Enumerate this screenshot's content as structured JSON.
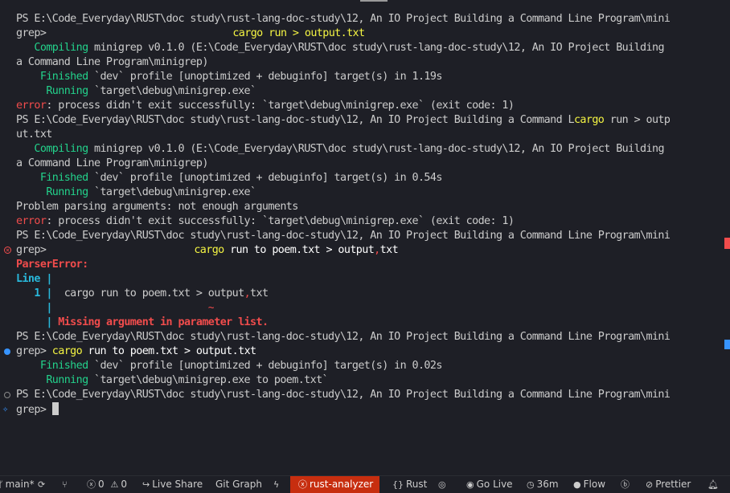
{
  "terminal": {
    "l1a": "PS E:\\Code_Everyday\\RUST\\doc study\\rust-lang-doc-study\\12, An IO Project Building a Command Line Program\\mini",
    "l2_prompt": "grep>",
    "l2_cmd": "cargo run > output.txt",
    "l3_kw": "Compiling",
    "l3_rest": " minigrep v0.1.0 (E:\\Code_Everyday\\RUST\\doc study\\rust-lang-doc-study\\12, An IO Project Building",
    "l4": "a Command Line Program\\minigrep)",
    "l5_kw": "Finished",
    "l5_rest": " `dev` profile [unoptimized + debuginfo] target(s) in 1.19s",
    "l6_kw": "Running",
    "l6_rest": " `target\\debug\\minigrep.exe`",
    "l7_kw": "error",
    "l7_rest": ": process didn't exit successfully: `target\\debug\\minigrep.exe` (exit code: 1)",
    "l8a": "PS E:\\Code_Everyday\\RUST\\doc study\\rust-lang-doc-study\\12, An IO Project Building a Command L",
    "l8_cmd": "cargo",
    "l8_rest": " run > outp",
    "l9": "ut.txt",
    "l10_kw": "Compiling",
    "l10_rest": " minigrep v0.1.0 (E:\\Code_Everyday\\RUST\\doc study\\rust-lang-doc-study\\12, An IO Project Building",
    "l11": "a Command Line Program\\minigrep)",
    "l12_kw": "Finished",
    "l12_rest": " `dev` profile [unoptimized + debuginfo] target(s) in 0.54s",
    "l13_kw": "Running",
    "l13_rest": " `target\\debug\\minigrep.exe`",
    "l14": "Problem parsing arguments: not enough arguments",
    "l15_kw": "error",
    "l15_rest": ": process didn't exit successfully: `target\\debug\\minigrep.exe` (exit code: 1)",
    "l16": "PS E:\\Code_Everyday\\RUST\\doc study\\rust-lang-doc-study\\12, An IO Project Building a Command Line Program\\mini",
    "l17_prompt": "grep>",
    "l17_cmd": "cargo",
    "l17_rest": " run to poem.txt > output",
    "l17_comma": ",",
    "l17_end": "txt",
    "l18": "ParserError:",
    "l19_label": "Line",
    "l19_bar": " |",
    "l20_num": "1",
    "l20_bar": " |",
    "l20_cmd": "  cargo run to poem.txt > output",
    "l20_comma": ",",
    "l20_end": "txt",
    "l21_bar": "|",
    "l21_tilde": "~",
    "l22_bar": "|",
    "l22_msg": " Missing argument in parameter list.",
    "l23": "PS E:\\Code_Everyday\\RUST\\doc study\\rust-lang-doc-study\\12, An IO Project Building a Command Line Program\\mini",
    "l24_prompt": "grep>",
    "l24_cmd": "cargo",
    "l24_rest": " run to poem.txt > output.txt",
    "l25_kw": "Finished",
    "l25_rest": " `dev` profile [unoptimized + debuginfo] target(s) in 0.02s",
    "l26_kw": "Running",
    "l26_rest": " `target\\debug\\minigrep.exe to poem.txt`",
    "l27": "PS E:\\Code_Everyday\\RUST\\doc study\\rust-lang-doc-study\\12, An IO Project Building a Command Line Program\\mini",
    "l28_prompt": "grep>"
  },
  "statusbar": {
    "branch": "main*",
    "sync_icon": "sync-icon",
    "errors": "0",
    "warnings": "0",
    "live_share": "Live Share",
    "git_graph": "Git Graph",
    "rust_analyzer": "rust-analyzer",
    "rust": "Rust",
    "go_live": "Go Live",
    "time": "36m",
    "flow": "Flow",
    "prettier": "Prettier"
  },
  "colors": {
    "background": "#1e1f26",
    "green": "#23d18b",
    "cyan": "#29b8db",
    "red": "#f14c4c",
    "rust_analyzer_bg": "#c72e0f"
  }
}
